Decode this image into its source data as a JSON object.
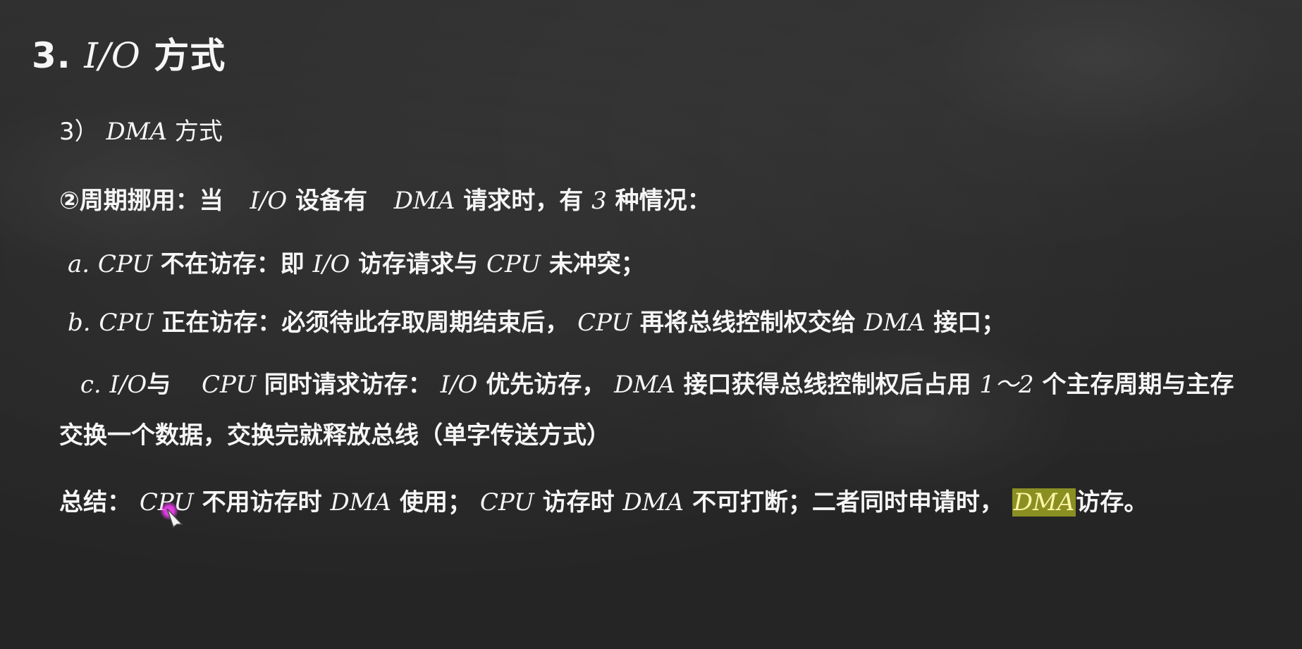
{
  "slide": {
    "title": {
      "prefix": "3.",
      "io": "I/O",
      "suffix": "方式"
    },
    "subtitle": {
      "prefix": "3）",
      "dma": "DMA",
      "suffix": "方式"
    },
    "line1": {
      "p1": "②周期挪用：当",
      "p2": "I/O",
      "p3": "设备有",
      "p4": "DMA",
      "p5": "请求时，有",
      "p6": "3",
      "p7": "种情况："
    },
    "line_a": {
      "label": "a.",
      "cpu": "CPU",
      "p1": "不在访存：即",
      "io": "I/O",
      "p2": "访存请求与",
      "cpu2": "CPU",
      "p3": "未冲突；"
    },
    "line_b": {
      "label": "b.",
      "cpu": "CPU",
      "p1": "正在访存：必须待此存取周期结束后，",
      "cpu2": "CPU",
      "p2": "再将总线控制权交给",
      "dma": "DMA",
      "p3": "接口；"
    },
    "line_c": {
      "label": "c.",
      "io": "I/O",
      "p1": "与",
      "cpu": "CPU",
      "p2": "同时请求访存：",
      "io2": "I/O",
      "p3": "优先访存，",
      "dma": "DMA",
      "p4": "接口获得总线控制权后占用",
      "range": "1～2",
      "p5": "个主存周期与主存交换一个数据，交换完就释放总线（单字传送方式）"
    },
    "summary": {
      "p1": "总结：",
      "cpu": "CPU",
      "p2": "不用访存时",
      "dma": "DMA",
      "p3": "使用；",
      "cpu2": "CPU",
      "p4": "访存时",
      "dma2": "DMA",
      "p5": "不可打断；二者同时申请时，",
      "dma3": "DMA",
      "p6": "访存。"
    }
  }
}
